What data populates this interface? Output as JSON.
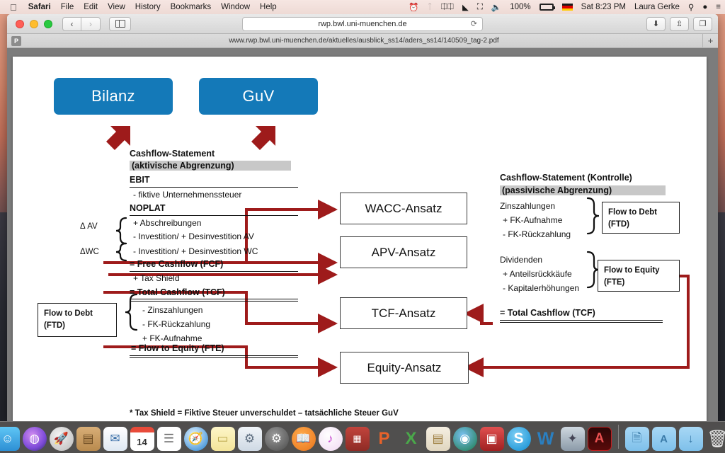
{
  "menubar": {
    "apple_icon": "apple-logo",
    "app_name": "Safari",
    "items": [
      "File",
      "Edit",
      "View",
      "History",
      "Bookmarks",
      "Window",
      "Help"
    ],
    "status": {
      "time_machine_icon": "clock-icon",
      "bluetooth_icon": "bluetooth-icon",
      "battery_percent": "100%",
      "input_flag": "german-flag",
      "clock": "Sat 8:23 PM",
      "user": "Laura Gerke",
      "search_icon": "search-icon",
      "siri_icon": "siri-icon",
      "notifications_icon": "list-icon"
    }
  },
  "browser": {
    "back_icon": "chevron-left-icon",
    "forward_icon": "chevron-right-icon",
    "sidebar_icon": "sidebar-icon",
    "url": "rwp.bwl.uni-muenchen.de",
    "reload_icon": "reload-icon",
    "download_icon": "download-icon",
    "share_icon": "share-icon",
    "tabs_icon": "tabs-icon",
    "tab_favicon_letter": "P",
    "tab_title": "www.rwp.bwl.uni-muenchen.de/aktuelles/ausblick_ss14/aders_ss14/140509_tag-2.pdf",
    "new_tab_label": "+"
  },
  "slide": {
    "sources": [
      {
        "label": "Bilanz"
      },
      {
        "label": "GuV"
      }
    ],
    "left_statement": {
      "title": "Cashflow-Statement",
      "subtitle": "(aktivische Abgrenzung)",
      "lines": [
        "EBIT",
        "- fiktive Unternehmenssteuer",
        "NOPLAT",
        "+ Abschreibungen",
        "- Investition/ + Desinvestition AV",
        "- Investition/ + Desinvestition WC",
        "= Free Cashflow (FCF)",
        "+ Tax Shield",
        "= Total Cashflow (TCF)",
        "- Zinszahlungen",
        "-  FK-Rückzahlung",
        "+ FK-Aufnahme",
        "= Flow to Equity (FTE)"
      ],
      "delta_av": "Δ AV",
      "delta_wc": "ΔWC"
    },
    "ftd_box_left": "Flow to Debt\n(FTD)",
    "ftd_box_left_line1": "Flow to Debt",
    "ftd_box_left_line2": "(FTD)",
    "approaches": [
      {
        "label": "WACC-Ansatz"
      },
      {
        "label": "APV-Ansatz"
      },
      {
        "label": "TCF-Ansatz"
      },
      {
        "label": "Equity-Ansatz"
      }
    ],
    "right_statement": {
      "title": "Cashflow-Statement (Kontrolle)",
      "subtitle": "(passivische Abgrenzung)",
      "debt_lines": [
        "Zinszahlungen",
        "+ FK-Aufnahme",
        "- FK-Rückzahlung"
      ],
      "equity_lines": [
        "Dividenden",
        "+ Anteilsrückkäufe",
        "- Kapitalerhöhungen"
      ],
      "ftd_box_line1": "Flow to Debt",
      "ftd_box_line2": "(FTD)",
      "fte_box_line1": "Flow to Equity",
      "fte_box_line2": "(FTE)",
      "total": "= Total Cashflow (TCF)"
    },
    "footnote": "* Tax Shield = Fiktive Steuer unverschuldet – tatsächliche Steuer GuV",
    "colors": {
      "blue_box": "#1479b8",
      "arrow_red": "#9e1b1b",
      "highlight_gray": "#c8c8c8"
    }
  },
  "dock": {
    "items": [
      {
        "name": "finder",
        "glyph": "☺"
      },
      {
        "name": "siri",
        "glyph": "◍"
      },
      {
        "name": "launchpad",
        "glyph": "🚀"
      },
      {
        "name": "contacts",
        "glyph": "▤"
      },
      {
        "name": "mail",
        "glyph": "✉"
      },
      {
        "name": "calendar",
        "glyph": "14"
      },
      {
        "name": "reminders",
        "glyph": "☰"
      },
      {
        "name": "safari",
        "glyph": "🧭"
      },
      {
        "name": "notes",
        "glyph": "▭"
      },
      {
        "name": "system-preferences-old",
        "glyph": "⚙"
      },
      {
        "name": "system-preferences",
        "glyph": "⚙"
      },
      {
        "name": "ibooks",
        "glyph": "📖"
      },
      {
        "name": "itunes",
        "glyph": "♪"
      },
      {
        "name": "photo-booth",
        "glyph": "▦"
      },
      {
        "name": "powerpoint",
        "glyph": "P"
      },
      {
        "name": "excel",
        "glyph": "X"
      },
      {
        "name": "numbers",
        "glyph": "▤"
      },
      {
        "name": "arcgis",
        "glyph": "◉"
      },
      {
        "name": "app-red",
        "glyph": "▣"
      },
      {
        "name": "skype",
        "glyph": "S"
      },
      {
        "name": "word",
        "glyph": "W"
      },
      {
        "name": "image-capture",
        "glyph": "✦"
      },
      {
        "name": "adobe-acrobat",
        "glyph": "A"
      }
    ],
    "folders": [
      {
        "name": "documents-folder",
        "glyph": "🗎"
      },
      {
        "name": "applications-folder",
        "glyph": "A"
      },
      {
        "name": "downloads-folder",
        "glyph": "↓"
      }
    ],
    "trash": {
      "name": "trash",
      "glyph": "🗑"
    }
  }
}
